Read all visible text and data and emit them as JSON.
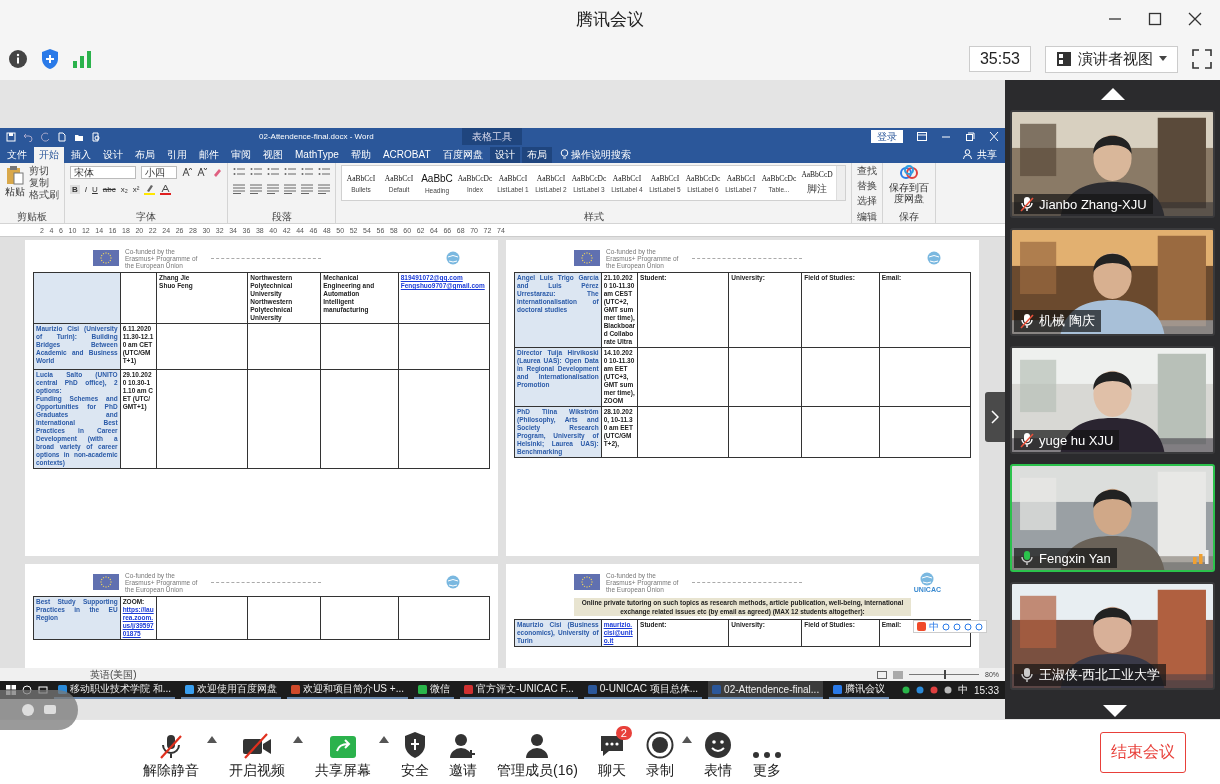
{
  "window": {
    "title": "腾讯会议"
  },
  "toolbar": {
    "timer": "35:53",
    "view_button": "演讲者视图"
  },
  "shared_screen": {
    "word": {
      "title": "02-Attendence-final.docx - Word",
      "context_tab": "表格工具",
      "login": "登录",
      "share": "共享",
      "tell_me": "操作说明搜索",
      "tabs": [
        {
          "label": "文件",
          "selected": false,
          "contextual": false
        },
        {
          "label": "开始",
          "selected": true,
          "contextual": false
        },
        {
          "label": "插入",
          "selected": false,
          "contextual": false
        },
        {
          "label": "设计",
          "selected": false,
          "contextual": false
        },
        {
          "label": "布局",
          "selected": false,
          "contextual": false
        },
        {
          "label": "引用",
          "selected": false,
          "contextual": false
        },
        {
          "label": "邮件",
          "selected": false,
          "contextual": false
        },
        {
          "label": "审阅",
          "selected": false,
          "contextual": false
        },
        {
          "label": "视图",
          "selected": false,
          "contextual": false
        },
        {
          "label": "MathType",
          "selected": false,
          "contextual": false
        },
        {
          "label": "帮助",
          "selected": false,
          "contextual": false
        },
        {
          "label": "ACROBAT",
          "selected": false,
          "contextual": false
        },
        {
          "label": "百度网盘",
          "selected": false,
          "contextual": false
        },
        {
          "label": "设计",
          "selected": false,
          "contextual": true
        },
        {
          "label": "布局",
          "selected": false,
          "contextual": true
        }
      ],
      "clipboard": {
        "paste": "粘贴",
        "cut": "剪切",
        "copy": "复制",
        "painter": "格式刷",
        "label": "剪贴板"
      },
      "font": {
        "name": "宋体",
        "size": "小四",
        "format_buttons": [
          "B",
          "I",
          "U",
          "abc",
          "x₂",
          "x²"
        ],
        "label": "字体"
      },
      "paragraph_label": "段落",
      "styles": [
        {
          "sample": "AaBbCcI",
          "name": "Bullets"
        },
        {
          "sample": "AaBbCcI",
          "name": "Default"
        },
        {
          "sample": "AaBbC",
          "name": "Heading"
        },
        {
          "sample": "AaBbCcDc",
          "name": "Index"
        },
        {
          "sample": "AaBbCcI",
          "name": "ListLabel 1"
        },
        {
          "sample": "AaBbCcI",
          "name": "ListLabel 2"
        },
        {
          "sample": "AaBbCcDc",
          "name": "ListLabel 3"
        },
        {
          "sample": "AaBbCcI",
          "name": "ListLabel 4"
        },
        {
          "sample": "AaBbCcI",
          "name": "ListLabel 5"
        },
        {
          "sample": "AaBbCcDc",
          "name": "ListLabel 6"
        },
        {
          "sample": "AaBbCcI",
          "name": "ListLabel 7"
        },
        {
          "sample": "AaBbCcDc",
          "name": "Table..."
        },
        {
          "sample": "AaBbCcD",
          "name": "脚注"
        }
      ],
      "styles_label": "样式",
      "editing": {
        "find": "查找",
        "replace": "替换",
        "select": "选择",
        "label": "编辑"
      },
      "save": {
        "button": "保存到百度网盘",
        "label": "保存"
      },
      "ruler": [
        "2",
        "4",
        "6",
        "10",
        "12",
        "14",
        "16",
        "18",
        "20",
        "22",
        "24",
        "26",
        "28",
        "30",
        "32",
        "34",
        "36",
        "38",
        "40",
        "42",
        "44",
        "46",
        "48",
        "50",
        "52",
        "54",
        "56",
        "58",
        "60",
        "62",
        "64",
        "66",
        "68",
        "70",
        "72",
        "74"
      ],
      "pages": [
        {
          "logo_text": "Co-funded by the Erasmus+ Programme of the European Union",
          "rows": [
            [
              null,
              null,
              [
                "Zhang Jie",
                "Shuo Feng"
              ],
              [
                "Northwestern Polytechnical University",
                "Northwestern Polytechnical University"
              ],
              [
                "Mechanical Engineering and Automation",
                "Intelligent manufacturing"
              ],
              [
                {
                  "text": "819491072@qq.com",
                  "link": true
                },
                {
                  "text": "Fengshuo9707@gmail.com",
                  "link": true
                }
              ]
            ],
            [
              [
                "Maurizio Cisi (University of Turin): Building Bridges Between Academic and Business World"
              ],
              [
                "6.11.2020 11.30-12.10 am CET (UTC/GMT+1)"
              ],
              null,
              null,
              null,
              null
            ],
            [
              [
                "Lucia Salto (UNITO central PhD office), 2 options:",
                "Funding Schemes and Opportunities for PhD Graduates and International Best Practices in Career Development (with a broad variety of career options in non-academic contexts)"
              ],
              [
                "29.10.2020 10.30-11.10 am CET (UTC/GMT+1)"
              ],
              null,
              null,
              null,
              null
            ]
          ]
        },
        {
          "logo_text": "Co-funded by the Erasmus+ Programme of the European Union",
          "rows": [
            [
              [
                "Angel Luis Trigo García and Luis Pérez Urrestarazu: The internationalisation of doctoral studies"
              ],
              [
                "21.10.2020 10-11.30 am CEST (UTC+2, GMT summer time), Blackboard Collaborate Ultra"
              ],
              [
                "Student:"
              ],
              [
                "University:"
              ],
              [
                "Field of Studies:"
              ],
              [
                "Email:"
              ]
            ],
            [
              [
                "Director Tuija Hirvikoski (Laurea UAS): Open Data in Regional Development and Internationalisation Promotion"
              ],
              [
                "14.10.2020 10-11.30 am EET (UTC+3, GMT summer time), ZOOM"
              ],
              null,
              null,
              null,
              null
            ],
            [
              [
                "PhD Tiina Wikström (Philosophy, Arts and Society Research Program, University of Helsinki; Laurea UAS): Benchmarking"
              ],
              [
                "28.10.2020, 10-11.30 am EET (UTC/GMT+2),"
              ],
              null,
              null,
              null,
              null
            ]
          ]
        },
        {
          "logo_text": "Co-funded by the Erasmus+ Programme of the European Union",
          "rows": [
            [
              [
                "Best Study Supporting Practices in the EU Region"
              ],
              [
                "ZOOM:",
                {
                  "text": "https://laurea.zoom.us/j/3959701875",
                  "link": true
                }
              ],
              null,
              null,
              null,
              null
            ]
          ]
        },
        {
          "logo_text": "Co-funded by the Erasmus+ Programme of the European Union",
          "brand": "UNICAC",
          "banner": "Online private tutoring on such topics as research methods, article publication, well-being, international exchange related issues etc (by email as agreed) (MAX 12 students altogether):",
          "ime_label": "中",
          "rows": [
            [
              [
                "Maurizio Cisi (Business economics), University of Turin"
              ],
              [
                {
                  "text": "maurizio.cisi@unito.it",
                  "link": true
                }
              ],
              [
                "Student:"
              ],
              [
                "University:"
              ],
              [
                "Field of Studies:"
              ],
              [
                "Email:"
              ]
            ]
          ]
        }
      ],
      "status": {
        "language": "英语(美国)",
        "zoom": "80%",
        "level": 0.5
      }
    },
    "taskbar": {
      "items": [
        {
          "label": "移动职业技术学院 和...",
          "selected": false
        },
        {
          "label": "欢迎使用百度网盘",
          "selected": false
        },
        {
          "label": "欢迎和项目简介US +...",
          "selected": false
        },
        {
          "label": "微信",
          "selected": false
        },
        {
          "label": "官方评文-UNICAC F...",
          "selected": false
        },
        {
          "label": "0-UNICAC 项目总体...",
          "selected": false
        },
        {
          "label": "02-Attendence-final...",
          "selected": true
        },
        {
          "label": "腾讯会议",
          "selected": false
        }
      ],
      "ime": "中",
      "time": "15:33"
    }
  },
  "participants": [
    {
      "name": "Jianbo Zhang-XJU",
      "muted": true,
      "speaking": false
    },
    {
      "name": "机械 陶庆",
      "muted": true,
      "speaking": false
    },
    {
      "name": "yuge hu XJU",
      "muted": true,
      "speaking": false
    },
    {
      "name": "Fengxin Yan",
      "muted": false,
      "speaking": true
    },
    {
      "name": "王淑侠-西北工业大学",
      "muted": false,
      "speaking": false
    }
  ],
  "controls": [
    {
      "label": "解除静音",
      "kind": "mic",
      "caret": true
    },
    {
      "label": "开启视频",
      "kind": "video",
      "caret": true
    },
    {
      "label": "共享屏幕",
      "kind": "share",
      "caret": true
    },
    {
      "label": "安全",
      "kind": "security",
      "caret": false
    },
    {
      "label": "邀请",
      "kind": "invite",
      "caret": false
    },
    {
      "label": "管理成员(16)",
      "kind": "members",
      "caret": false
    },
    {
      "label": "聊天",
      "kind": "chat",
      "caret": false,
      "badge": "2"
    },
    {
      "label": "录制",
      "kind": "record",
      "caret": true
    },
    {
      "label": "表情",
      "kind": "reaction",
      "caret": false
    },
    {
      "label": "更多",
      "kind": "more",
      "caret": false
    }
  ],
  "end_button": "结束会议"
}
